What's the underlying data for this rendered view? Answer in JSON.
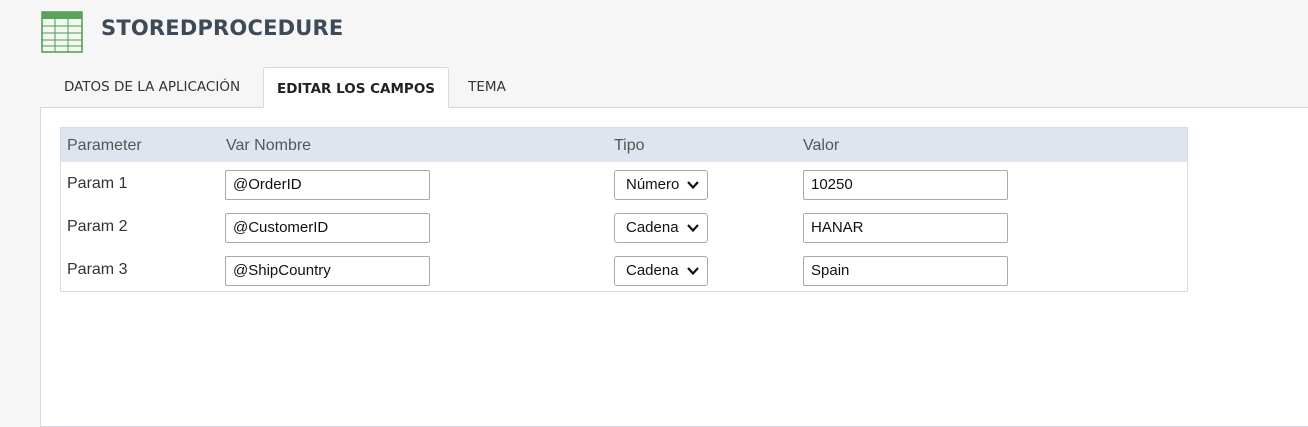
{
  "app": {
    "title": "STOREDPROCEDURE",
    "icon": "table-grid-icon",
    "icon_color": "#4d9a54"
  },
  "tabs": [
    {
      "label": "DATOS DE LA APLICACIÓN",
      "active": false
    },
    {
      "label": "EDITAR LOS CAMPOS",
      "active": true
    },
    {
      "label": "TEMA",
      "active": false
    }
  ],
  "grid": {
    "columns": [
      "Parameter",
      "Var Nombre",
      "Tipo",
      "Valor"
    ],
    "header_bg": "#dfe5ee",
    "rows": [
      {
        "param": "Param 1",
        "var_name": "@OrderID",
        "tipo": "Número",
        "valor": "10250"
      },
      {
        "param": "Param 2",
        "var_name": "@CustomerID",
        "tipo": "Cadena",
        "valor": "HANAR"
      },
      {
        "param": "Param 3",
        "var_name": "@ShipCountry",
        "tipo": "Cadena",
        "valor": "Spain"
      }
    ]
  }
}
